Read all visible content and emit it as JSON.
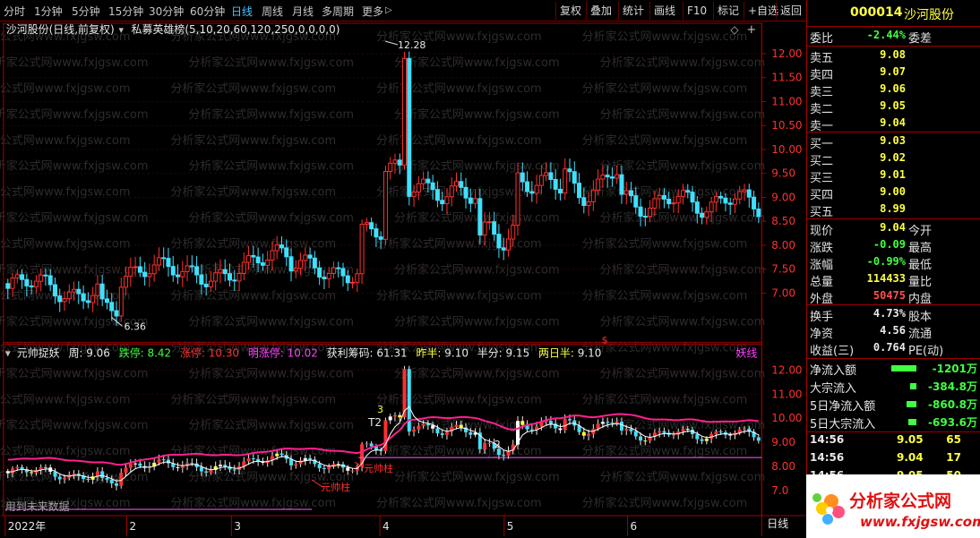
{
  "toolbar": {
    "periods": [
      "分时",
      "1分钟",
      "5分钟",
      "15分钟",
      "30分钟",
      "60分钟",
      "日线",
      "周线",
      "月线",
      "多周期",
      "更多"
    ],
    "active_period": "日线",
    "more_arrow": "▷",
    "actions": [
      "复权",
      "叠加",
      "统计",
      "画线",
      "F10",
      "标记",
      "+自选",
      "返回"
    ]
  },
  "chart_header": {
    "stock": "沙河股份(日线,前复权)",
    "indicator": "私募英雄榜(5,10,20,60,120,250,0,0,0,0)",
    "diamond": "◇",
    "expand": "+"
  },
  "price_axis": [
    "12.00",
    "11.50",
    "11.00",
    "10.50",
    "10.00",
    "9.50",
    "9.00",
    "8.50",
    "8.00",
    "7.50",
    "7.00"
  ],
  "price_annotations": {
    "high": "12.28",
    "low": "6.36"
  },
  "sub_header": {
    "name": "元帅捉妖",
    "week_label": "周:",
    "week_value": "9.06",
    "limit_down_label": "跌停:",
    "limit_down_value": "8.42",
    "limit_up_label": "涨停:",
    "limit_up_value": "10.30",
    "next_limit_label": "明涨停:",
    "next_limit_value": "10.02",
    "chips_label": "获利筹码:",
    "chips_value": "61.31",
    "prev_half_label": "昨半:",
    "prev_half_value": "9.10",
    "half_label": "半分:",
    "half_value": "9.15",
    "twoday_label": "两日半:",
    "twoday_value": "9.10",
    "tag": "妖线"
  },
  "sub_axis": [
    "12.00",
    "11.00",
    "10.00",
    "9.00",
    "8.00",
    "7.0"
  ],
  "sub_labels": {
    "pillar": "元帅柱",
    "pillar2": "元帅柱",
    "future": "用到未来数据",
    "t2a": "T2",
    "t2b": "2",
    "t3": "3",
    "s_mark": "$"
  },
  "date_axis": [
    "2022年",
    "2",
    "3",
    "4",
    "5",
    "6"
  ],
  "bottom_tag": "日线",
  "quote": {
    "code": "000014",
    "name": "沙河股份",
    "webi_label": "委比",
    "webi_value": "-2.44%",
    "weicha_label": "委差",
    "asks": [
      {
        "label": "卖五",
        "price": "9.08"
      },
      {
        "label": "卖四",
        "price": "9.07"
      },
      {
        "label": "卖三",
        "price": "9.06"
      },
      {
        "label": "卖二",
        "price": "9.05"
      },
      {
        "label": "卖一",
        "price": "9.04"
      }
    ],
    "bids": [
      {
        "label": "买一",
        "price": "9.03"
      },
      {
        "label": "买二",
        "price": "9.02"
      },
      {
        "label": "买三",
        "price": "9.01"
      },
      {
        "label": "买四",
        "price": "9.00"
      },
      {
        "label": "买五",
        "price": "8.99"
      }
    ],
    "stats": [
      {
        "label": "现价",
        "value": "9.04",
        "right": "今开"
      },
      {
        "label": "涨跌",
        "value": "-0.09",
        "right": "最高"
      },
      {
        "label": "涨幅",
        "value": "-0.99%",
        "right": "最低"
      },
      {
        "label": "总量",
        "value": "114433",
        "right": "量比"
      },
      {
        "label": "外盘",
        "value": "50475",
        "right": "内盘"
      }
    ],
    "stats2": [
      {
        "label": "换手",
        "value": "4.73%",
        "right": "股本"
      },
      {
        "label": "净资",
        "value": "4.56",
        "right": "流通"
      },
      {
        "label": "收益(三)",
        "value": "0.764",
        "right": "PE(动)"
      }
    ],
    "flows": [
      {
        "label": "净流入额",
        "value": "-1201万"
      },
      {
        "label": "大宗流入",
        "value": "-384.8万"
      },
      {
        "label": "5日净流入额",
        "value": "-860.8万"
      },
      {
        "label": "5日大宗流入",
        "value": "-693.6万"
      }
    ],
    "ticks": [
      {
        "time": "14:56",
        "price": "9.05",
        "vol": "65"
      },
      {
        "time": "14:56",
        "price": "9.04",
        "vol": "17"
      },
      {
        "time": "14:56",
        "price": "9.05",
        "vol": "50"
      },
      {
        "time": "14:56",
        "price": "9.04",
        "vol": "10"
      }
    ]
  },
  "logo": {
    "brand": "分析家公式网",
    "url": "www.fxjgsw.com"
  },
  "watermark": "分析家公式网www.fxjgsw.com",
  "colors": {
    "up": "#ff3030",
    "down": "#40e0ff",
    "pink": "#ff2090",
    "frame": "#a00000"
  }
}
